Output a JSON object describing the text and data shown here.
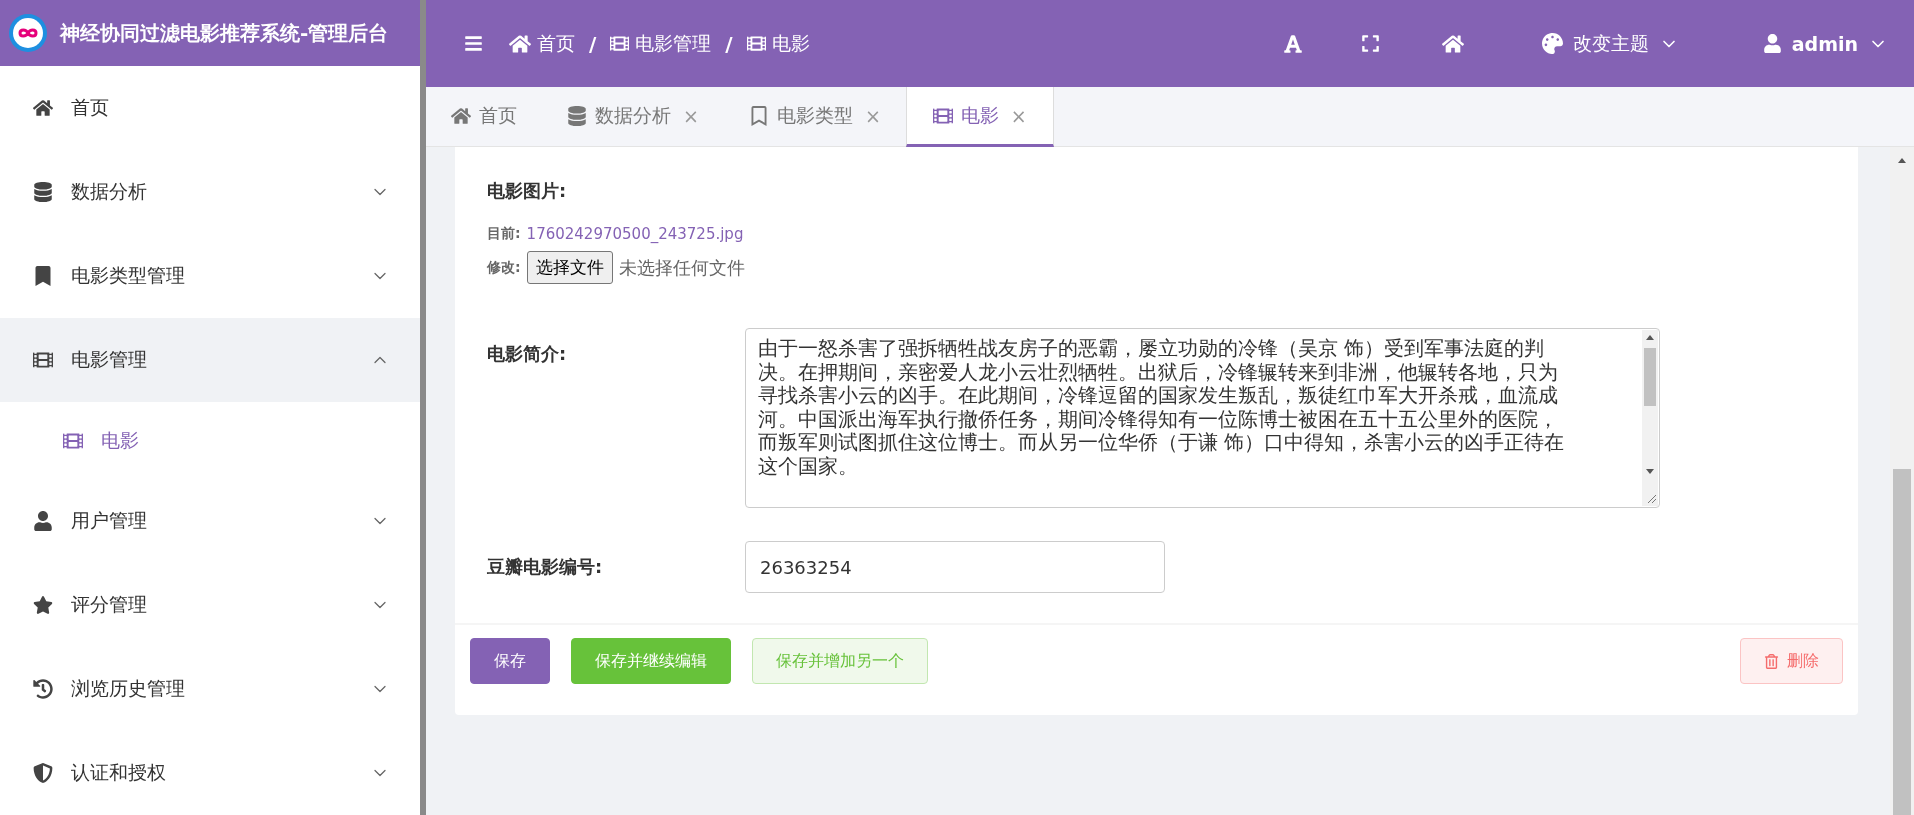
{
  "header": {
    "title": "神经协同过滤电影推荐系统-管理后台",
    "breadcrumb": [
      {
        "label": "首页",
        "separator": "/"
      },
      {
        "label": "电影管理",
        "separator": "/"
      },
      {
        "label": "电影"
      }
    ],
    "theme_menu": "改变主题",
    "user": "admin"
  },
  "sidebar": {
    "items": [
      {
        "label": "首页",
        "kind": "link"
      },
      {
        "label": "数据分析",
        "kind": "group",
        "expanded": false
      },
      {
        "label": "电影类型管理",
        "kind": "group",
        "expanded": false
      },
      {
        "label": "电影管理",
        "kind": "group",
        "expanded": true,
        "children": [
          {
            "label": "电影",
            "selected": true
          }
        ]
      },
      {
        "label": "用户管理",
        "kind": "group",
        "expanded": false
      },
      {
        "label": "评分管理",
        "kind": "group",
        "expanded": false
      },
      {
        "label": "浏览历史管理",
        "kind": "group",
        "expanded": false
      },
      {
        "label": "认证和授权",
        "kind": "group",
        "expanded": false
      }
    ]
  },
  "tabs": [
    {
      "label": "首页",
      "selected": false
    },
    {
      "label": "数据分析",
      "close": "×",
      "selected": false
    },
    {
      "label": "电影类型",
      "close": "×",
      "selected": false
    },
    {
      "label": "电影",
      "close": "×",
      "selected": true
    }
  ],
  "form": {
    "fields": [
      {
        "kind": "image",
        "label": "电影图片:",
        "current_label": "目前:",
        "current_value": "1760242970500_243725.jpg",
        "change_label": "修改:",
        "button": "选择文件",
        "file_status": "未选择任何文件"
      },
      {
        "kind": "textarea",
        "label": "电影简介:",
        "value": "由于一怒杀害了强拆牺牲战友房子的恶霸，屡立功勋的冷锋（吴京 饰）受到军事法庭的判决。在押期间，亲密爱人龙小云壮烈牺牲。出狱后，冷锋辗转来到非洲，他辗转各地，只为寻找杀害小云的凶手。在此期间，冷锋逗留的国家发生叛乱，叛徒红巾军大开杀戒，血流成河。中国派出海军执行撤侨任务，期间冷锋得知有一位陈博士被困在五十五公里外的医院，而叛军则试图抓住这位博士。而从另一位华侨（于谦 饰）口中得知，杀害小云的凶手正待在这个国家。"
      },
      {
        "kind": "text",
        "label": "豆瓣电影编号:",
        "value": "26363254"
      }
    ],
    "actions": [
      {
        "label": "保存",
        "kind": "primary"
      },
      {
        "label": "保存并继续编辑",
        "kind": "success"
      },
      {
        "label": "保存并增加另一个",
        "kind": "success-plain"
      },
      {
        "label": "删除",
        "kind": "danger-plain"
      }
    ]
  }
}
